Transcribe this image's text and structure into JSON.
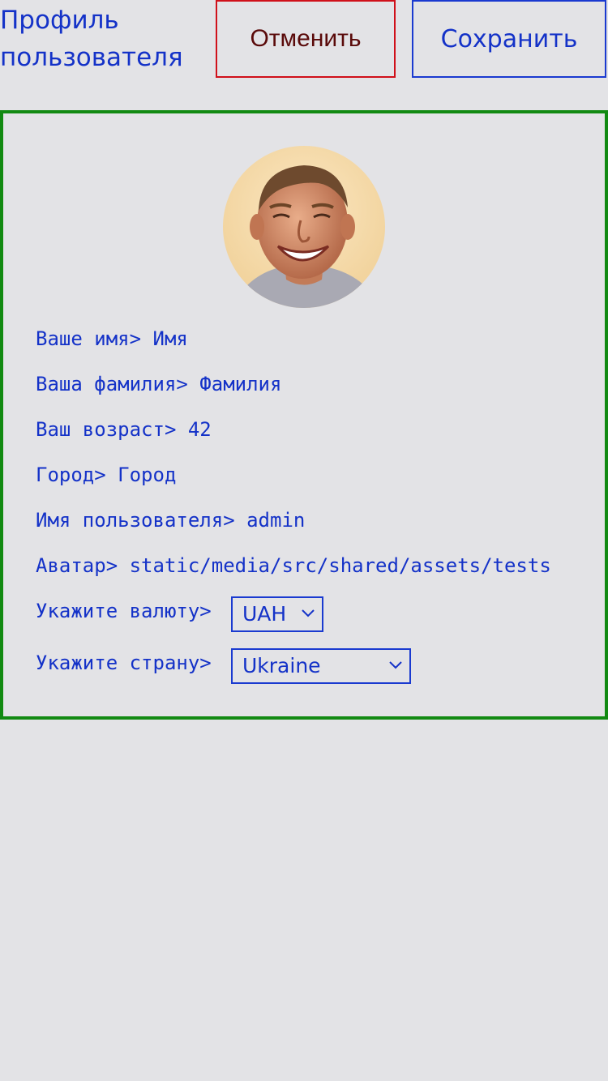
{
  "header": {
    "title": "Профиль пользователя",
    "cancel_label": "Отменить",
    "save_label": "Сохранить"
  },
  "profile": {
    "fields": [
      {
        "label": "Ваше имя>",
        "value": "Имя"
      },
      {
        "label": "Ваша фамилия>",
        "value": "Фамилия"
      },
      {
        "label": "Ваш возраст>",
        "value": "42"
      },
      {
        "label": "Город>",
        "value": "Город"
      },
      {
        "label": "Имя пользователя>",
        "value": "admin"
      },
      {
        "label": "Аватар>",
        "value": "static/media/src/shared/assets/tests"
      }
    ],
    "currency": {
      "label": "Укажите валюту>",
      "selected": "UAH"
    },
    "country": {
      "label": "Укажите страну>",
      "selected": "Ukraine"
    }
  },
  "colors": {
    "background": "#e3e3e6",
    "text": "#1432c8",
    "cancel_border": "#d0101a",
    "cancel_text": "#5a0a0a",
    "save_border": "#1a3ad0",
    "card_border": "#128a12"
  },
  "icons": {
    "avatar": "user-photo",
    "select_arrow": "chevron-down-icon"
  }
}
